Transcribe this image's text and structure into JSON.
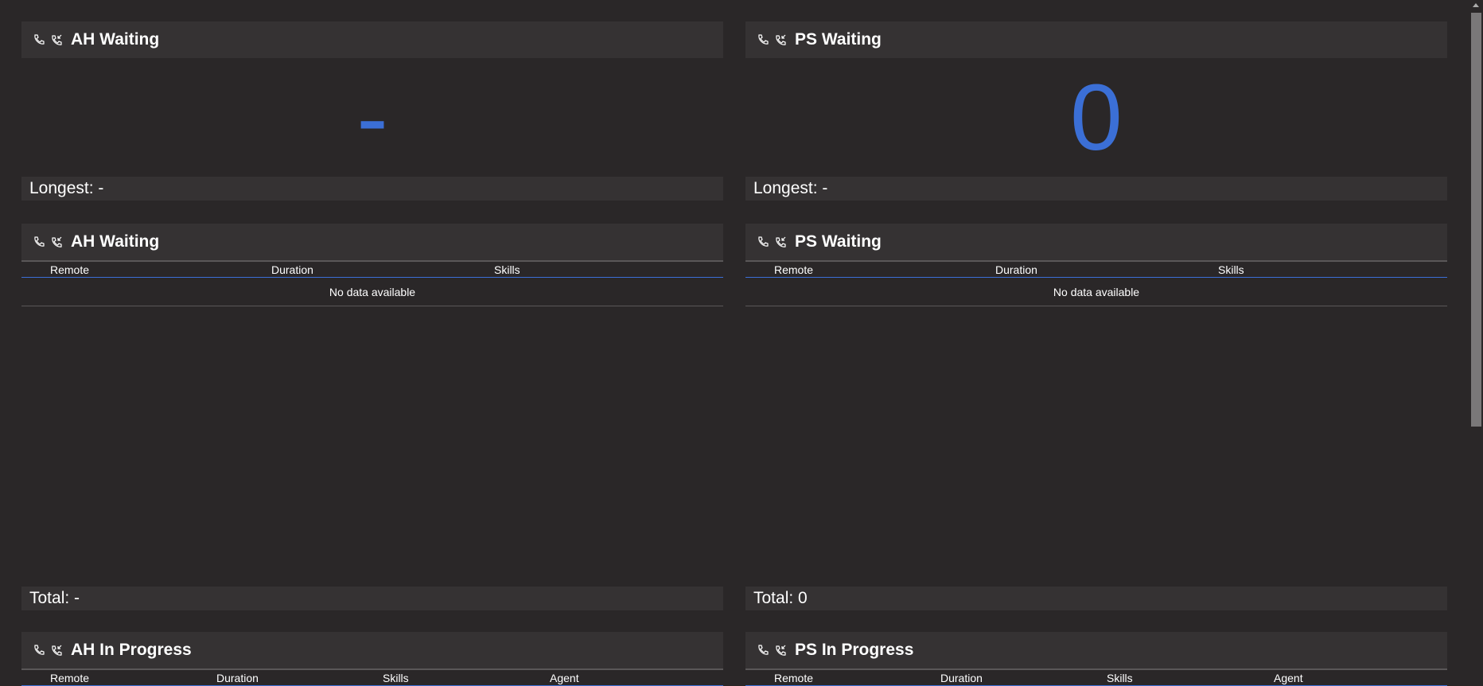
{
  "panels": {
    "ah_waiting_stat": {
      "title": "AH Waiting",
      "value": "-",
      "footer": "Longest: -"
    },
    "ps_waiting_stat": {
      "title": "PS Waiting",
      "value": "0",
      "footer": "Longest: -"
    },
    "ah_waiting_table": {
      "title": "AH Waiting",
      "columns": [
        "Remote",
        "Duration",
        "Skills"
      ],
      "empty": "No data available",
      "footer": "Total: -"
    },
    "ps_waiting_table": {
      "title": "PS Waiting",
      "columns": [
        "Remote",
        "Duration",
        "Skills"
      ],
      "empty": "No data available",
      "footer": "Total: 0"
    },
    "ah_in_progress": {
      "title": "AH In Progress",
      "columns": [
        "Remote",
        "Duration",
        "Skills",
        "Agent"
      ]
    },
    "ps_in_progress": {
      "title": "PS In Progress",
      "columns": [
        "Remote",
        "Duration",
        "Skills",
        "Agent"
      ]
    }
  },
  "colors": {
    "accent": "#3b6fd6",
    "header_bg": "#353233",
    "page_bg": "#2a2728"
  },
  "icons": [
    "phone-icon",
    "phone-incoming-icon"
  ]
}
